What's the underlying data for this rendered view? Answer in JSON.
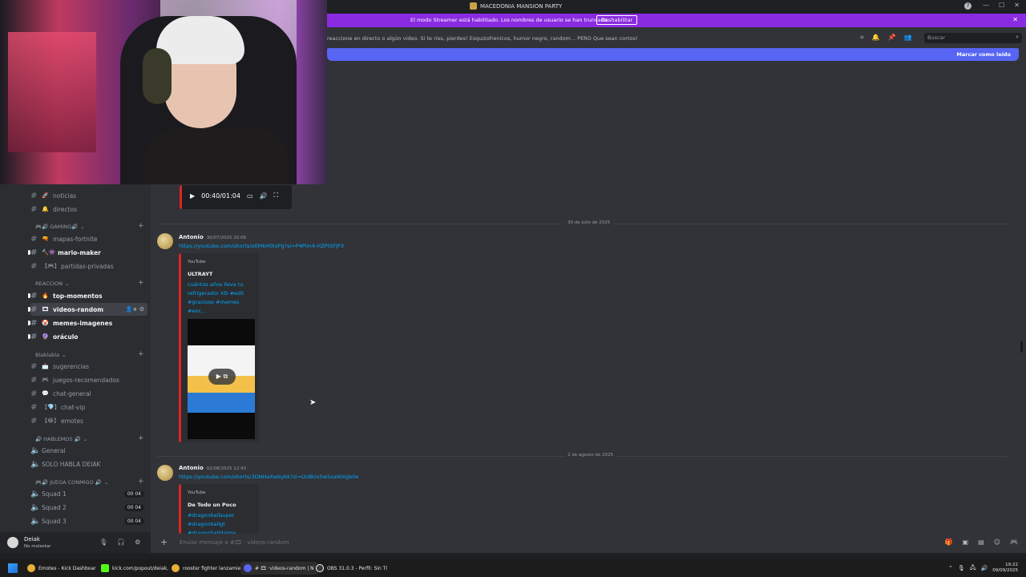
{
  "window": {
    "title": "MACEDONIA MANSION PARTY"
  },
  "banner": {
    "text": "El modo Streamer está habilitado. Los nombres de usuario se han truncado.",
    "button": "Deshabilitar"
  },
  "header": {
    "topic": "reaccione en directo o algún video. Si te ríes, pierdes! Esquizofrenicos, humor negro, random... PERO Que sean cortos!",
    "search_placeholder": "Buscar",
    "mark_read": "Marcar como leído"
  },
  "sidebar": {
    "channels_top": [
      {
        "emoji": "🚀",
        "label": "noticias"
      },
      {
        "emoji": "🔔",
        "label": "directos"
      }
    ],
    "cat_gaming": "🎮🔊 GAMING🔊",
    "gaming": [
      {
        "emoji": "🔫",
        "label": "mapas-fortnite"
      },
      {
        "emoji": "🔨👾",
        "label": "mario-maker"
      },
      {
        "emoji": "【🎮】",
        "label": "partidas-privadas"
      }
    ],
    "cat_reaccion": "REACCION",
    "reaccion": [
      {
        "emoji": "🔥",
        "label": "top-momentos"
      },
      {
        "emoji": "🎞",
        "label": "videos-random"
      },
      {
        "emoji": "🤡",
        "label": "memes-imagenes"
      },
      {
        "emoji": "🔮",
        "label": "oráculo"
      }
    ],
    "cat_blablabla": "Blablabla",
    "blablabla": [
      {
        "emoji": "📩",
        "label": "sugerencias"
      },
      {
        "emoji": "🎮",
        "label": "juegos-recomendados"
      },
      {
        "emoji": "💬",
        "label": "chat-general"
      },
      {
        "emoji": "【💎】",
        "label": "chat-vip"
      },
      {
        "emoji": "【😂】",
        "label": "emotes"
      }
    ],
    "cat_hablemos": "🔊 HABLEMOS 🔊",
    "hablemos": [
      {
        "label": "General"
      },
      {
        "label": "SOLO HABLA DEIAK"
      }
    ],
    "cat_juega": "🎮🔊 JUEGA CONMIGO 🔊",
    "juega": [
      {
        "label": "Squad 1",
        "count": "00 04"
      },
      {
        "label": "Squad 2",
        "count": "00 04"
      },
      {
        "label": "Squad 3",
        "count": "00 04"
      }
    ]
  },
  "user": {
    "name": "Deiak",
    "status": "No molestar"
  },
  "player": {
    "time": "00:40/01:04"
  },
  "dividers": [
    "30 de julio de 2025",
    "2 de agosto de 2025"
  ],
  "messages": [
    {
      "author": "Antonio",
      "time": "30/07/2025 20:06",
      "link": "https://youtube.com/shorts/otlMkH0txPg?si=P4Plm4-HZPtSFJP3",
      "provider": "YouTube",
      "title": "ULTRAYT",
      "desc": "cuántos años lleva tu refrigerador XD #edit #gracioso #memes #enc..."
    },
    {
      "author": "Antonio",
      "time": "02/08/2025 12:43",
      "link": "https://youtube.com/shorts/3DNHaXwbybk?si=UUBUx5w5xaWXgb0e",
      "provider": "YouTube",
      "title": "De Todo un Poco",
      "desc": "#dragonballsuper #dragonballgt #dragonballdaima"
    }
  ],
  "composer": {
    "placeholder": "Enviar mensaje a #🎞 · videos-random"
  },
  "taskbar": {
    "items": [
      {
        "label": "Emotes - Kick Dashboar",
        "color": "#e8b03a"
      },
      {
        "label": "kick.com/popout/deiak,",
        "color": "#53fc18"
      },
      {
        "label": "rooster fighter lanzamie",
        "color": "#e8b03a"
      },
      {
        "label": "# 🎞 ·videos-random | N",
        "color": "#5865f2"
      },
      {
        "label": "OBS 31.0.3 - Perfil: Sin Tí",
        "color": "#ffffff"
      }
    ],
    "time": "19:22",
    "date": "09/09/2025"
  }
}
